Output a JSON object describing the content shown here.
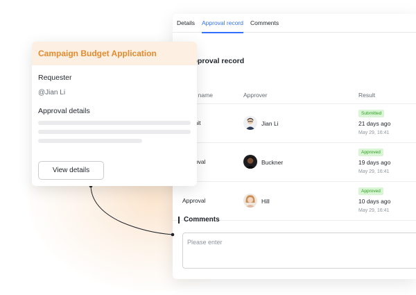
{
  "tabs": [
    {
      "label": "Details",
      "active": false
    },
    {
      "label": "Approval record",
      "active": true
    },
    {
      "label": "Comments",
      "active": false
    }
  ],
  "approval": {
    "title": "Approval record",
    "columns": {
      "node": "Node name",
      "approver": "Approver",
      "result": "Result"
    },
    "rows": [
      {
        "node": "Submit",
        "approver": "Jian Li",
        "status": "Submitted",
        "days": "21 days ago",
        "timestamp": "May 29, 16:41",
        "avatar_bg": "#f1d3b8"
      },
      {
        "node": "Approval",
        "approver": "Buckner",
        "status": "Approved",
        "days": "19 days ago",
        "timestamp": "May 29, 16:41",
        "avatar_bg": "#3a2a22"
      },
      {
        "node": "Approval",
        "approver": "Hill",
        "status": "Approved",
        "days": "10 days ago",
        "timestamp": "May 29, 16:41",
        "avatar_bg": "#e8c49a"
      }
    ]
  },
  "comments": {
    "title": "Comments",
    "placeholder": "Please enter"
  },
  "card": {
    "title": "Campaign Budget Application",
    "requester_label": "Requester",
    "requester_value": "@Jian Li",
    "details_label": "Approval details",
    "button_label": "View details"
  },
  "colors": {
    "accent": "#3370ff",
    "card_title": "#e38a2e",
    "card_header_bg": "#fdf0e3",
    "badge_bg": "#d9f5d6",
    "badge_text": "#2ea121"
  }
}
